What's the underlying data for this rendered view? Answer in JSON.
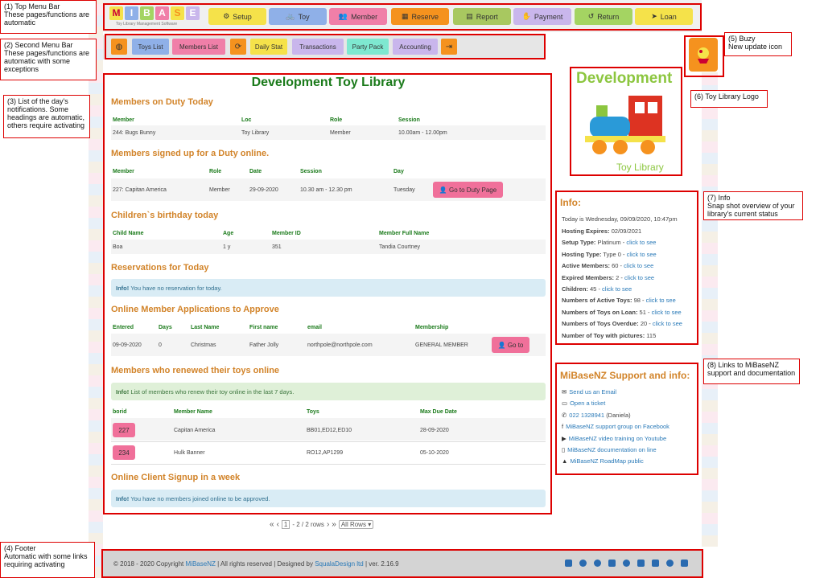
{
  "notes": {
    "n1": {
      "title": "(1) Top Menu Bar",
      "body": "These pages/functions are automatic"
    },
    "n2": {
      "title": "(2) Second Menu Bar",
      "body": "These pages/functions are automatic with some exceptions"
    },
    "n3": {
      "title": "(3) List of the day's notifications. Some headings are automatic, others require activating"
    },
    "n4": {
      "title": "(4) Footer",
      "body": "Automatic with some links requiring activating"
    },
    "n5": {
      "title": "(5) Buzy",
      "body": "New update icon"
    },
    "n6": {
      "title": "(6) Toy Library Logo"
    },
    "n7": {
      "title": "(7) Info",
      "body": "Snap shot overview of your library's current status"
    },
    "n8": {
      "title": "(8) Links to MiBaseNZ support and documentation"
    }
  },
  "logo": {
    "letters": [
      "M",
      "I",
      "B",
      "A",
      "S",
      "E"
    ],
    "sub": "Toy Library Management Software"
  },
  "topmenu": [
    {
      "label": "Setup",
      "icon": "gears-icon",
      "color": "#f5e24a"
    },
    {
      "label": "Toy",
      "icon": "bike-icon",
      "color": "#8fb0e8"
    },
    {
      "label": "Member",
      "icon": "users-icon",
      "color": "#f07fa8"
    },
    {
      "label": "Reserve",
      "icon": "calendar-icon",
      "color": "#f5921e"
    },
    {
      "label": "Report",
      "icon": "chart-icon",
      "color": "#a8c860"
    },
    {
      "label": "Payment",
      "icon": "hand-coin-icon",
      "color": "#c9b6ec"
    },
    {
      "label": "Return",
      "icon": "undo-icon",
      "color": "#a4d462"
    },
    {
      "label": "Loan",
      "icon": "send-icon",
      "color": "#f5e24a"
    }
  ],
  "secondmenu": [
    {
      "label": "",
      "icon": "globe-icon",
      "color": "#f5921e"
    },
    {
      "label": "Toys List",
      "color": "#8fb0e8"
    },
    {
      "label": "Members List",
      "color": "#f07fa8"
    },
    {
      "label": "",
      "icon": "refresh-icon",
      "color": "#f5921e"
    },
    {
      "label": "Daily Stat",
      "color": "#f5e24a"
    },
    {
      "label": "Transactions",
      "color": "#c9b6ec"
    },
    {
      "label": "Party Pack",
      "color": "#7ee8d0"
    },
    {
      "label": "Accounting",
      "color": "#c9b6ec"
    },
    {
      "label": "",
      "icon": "sign-out-icon",
      "color": "#f5921e"
    }
  ],
  "title": "Development Toy Library",
  "duty": {
    "heading": "Members on Duty Today",
    "cols": [
      "Member",
      "Loc",
      "Role",
      "Session"
    ],
    "row": [
      "244: Bugs Bunny",
      "Toy Library",
      "Member",
      "10.00am - 12.00pm"
    ]
  },
  "signup": {
    "heading": "Members signed up for a Duty online.",
    "cols": [
      "Member",
      "Role",
      "Date",
      "Session",
      "Day"
    ],
    "row": [
      "227: Capitan America",
      "Member",
      "29-09-2020",
      "10.30 am - 12.30 pm",
      "Tuesday"
    ],
    "button": "Go to Duty Page"
  },
  "birthday": {
    "heading": "Children`s birthday today",
    "cols": [
      "Child Name",
      "Age",
      "Member ID",
      "Member Full Name"
    ],
    "row": [
      "Boa",
      "1 y",
      "351",
      "Tandia Courtney"
    ]
  },
  "reservations": {
    "heading": "Reservations for Today",
    "info_bold": "Info!",
    "info": "You have no reservation for today."
  },
  "applications": {
    "heading": "Online Member Applications to Approve",
    "cols": [
      "Entered",
      "Days",
      "Last Name",
      "First name",
      "email",
      "Membership"
    ],
    "row": [
      "09-09-2020",
      "0",
      "Christmas",
      "Father Jolly",
      "northpole@northpole.com",
      "GENERAL MEMBER"
    ],
    "button": "Go to"
  },
  "renewed": {
    "heading": "Members who renewed their toys online",
    "info_bold": "Info!",
    "info": "List of members who renew their toy online in the last 7 days.",
    "cols": [
      "borid",
      "Member Name",
      "Toys",
      "Max Due Date"
    ],
    "rows": [
      [
        "227",
        "Capitan America",
        "BB01,ED12,ED10",
        "28-09-2020"
      ],
      [
        "234",
        "Hulk Banner",
        "RO12,AP1299",
        "05-10-2020"
      ]
    ]
  },
  "clientsignup": {
    "heading": "Online Client Signup in a week",
    "info_bold": "Info!",
    "info": "You have no members joined online to be approved."
  },
  "pager": {
    "page": "1",
    "text": "- 2 / 2 rows",
    "select": "All Rows"
  },
  "side": {
    "logo_top": "Development",
    "logo_bottom": "Toy Library",
    "info_heading": "Info:",
    "today": "Today is Wednesday, 09/09/2020, 10:47pm",
    "items": [
      {
        "label": "Hosting Expires:",
        "value": "02/09/2021",
        "link": ""
      },
      {
        "label": "Setup Type:",
        "value": "Platinum -",
        "link": "click to see"
      },
      {
        "label": "Hosting Type:",
        "value": "Type 0 -",
        "link": "click to see"
      },
      {
        "label": "Active Members:",
        "value": "60 -",
        "link": "click to see"
      },
      {
        "label": "Expired Members:",
        "value": "2 -",
        "link": "click to see"
      },
      {
        "label": "Children:",
        "value": "45 -",
        "link": "click to see"
      },
      {
        "label": "Numbers of Active Toys:",
        "value": "98 -",
        "link": "click to see"
      },
      {
        "label": "Numbers of Toys on Loan:",
        "value": "51 -",
        "link": "click to see"
      },
      {
        "label": "Numbers of Toys Overdue:",
        "value": "20 -",
        "link": "click to see"
      },
      {
        "label": "Number of Toy with pictures:",
        "value": "115",
        "link": ""
      }
    ],
    "support_heading": "MiBaseNZ Support and info:",
    "support": [
      {
        "icon": "envelope-icon",
        "text": "Send us an Email",
        "link": true
      },
      {
        "icon": "ticket-icon",
        "text": "Open a ticket",
        "link": true
      },
      {
        "icon": "phone-icon",
        "text": "022 1328941",
        "extra": "(Daniela)",
        "link": true
      },
      {
        "icon": "facebook-icon",
        "text": "MiBaseNZ support group on Facebook",
        "link": true
      },
      {
        "icon": "youtube-icon",
        "text": "MiBaseNZ video training on Youtube",
        "link": true
      },
      {
        "icon": "book-icon",
        "text": "MiBaseNZ documentation on line",
        "link": true
      },
      {
        "icon": "road-icon",
        "text": "MiBaseNZ RoadMap public",
        "link": true
      }
    ]
  },
  "footer": {
    "pre": "© 2018 - 2020 Copyright",
    "brand": "MiBaseNZ",
    "mid": "| All rights reserved | Designed by",
    "designer": "SqualaDesign ltd",
    "ver": "| ver. 2.16.9"
  },
  "colors": {
    "accent_green": "#1a7a1a",
    "heading_orange": "#d2842a",
    "annot_red": "#dd0000",
    "link": "#2a7ab8"
  }
}
